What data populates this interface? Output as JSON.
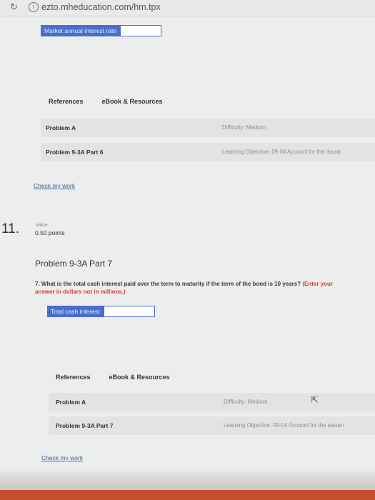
{
  "browser": {
    "url": "ezto.mheducation.com/hm.tpx"
  },
  "prev_question": {
    "input_label": "Market annual interest rate",
    "input_value": "",
    "tabs": [
      "References",
      "eBook & Resources"
    ],
    "rows": [
      {
        "name": "Problem A",
        "meta": "Difficulty: Medium"
      },
      {
        "name": "Problem 9-3A Part 6",
        "meta": "Learning Objective: 09-04 Account for the issuar"
      }
    ],
    "check_link": "Check my work"
  },
  "question": {
    "number": "11.",
    "value_label": "value:",
    "points": "0.50 points",
    "heading": "Problem 9-3A Part 7",
    "prompt": "7. What is the total cash interest paid over the term to maturity if the term of the bond is 10 years?",
    "hint": "(Enter your answer in dollars not in millions.)",
    "input_label": "Total cash interest",
    "input_value": "",
    "tabs": [
      "References",
      "eBook & Resources"
    ],
    "rows": [
      {
        "name": "Problem A",
        "meta": "Difficulty: Medium"
      },
      {
        "name": "Problem 9-3A Part 7",
        "meta": "Learning Objective: 09-04 Account for the issuan"
      }
    ],
    "check_link": "Check my work"
  },
  "colors": {
    "input_label_bg": "#4a6fcb",
    "hint": "#d83b2f",
    "link": "#3d5d9e",
    "footer": "#c3502d"
  }
}
